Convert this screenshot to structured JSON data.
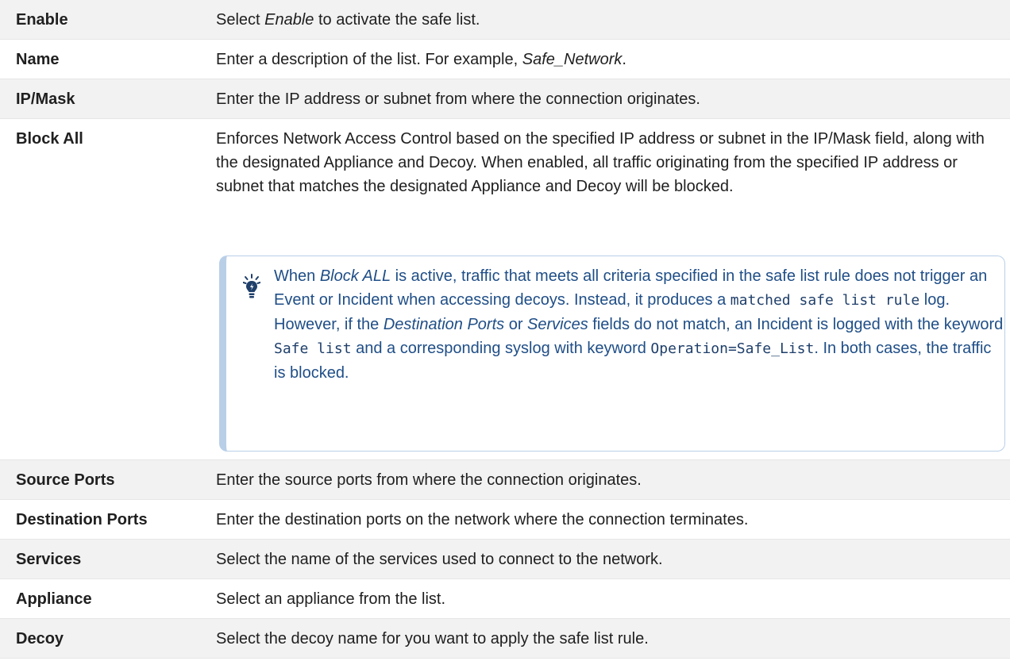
{
  "rows": [
    {
      "label": "Enable",
      "desc": [
        "Select ",
        {
          "i": "Enable"
        },
        " to activate the safe list."
      ]
    },
    {
      "label": "Name",
      "desc": [
        "Enter a description of the list. For example, ",
        {
          "i": "Safe_Network"
        },
        "."
      ]
    },
    {
      "label": "IP/Mask",
      "desc": [
        "Enter the IP address or subnet from where the connection originates."
      ]
    },
    {
      "label": "Block All",
      "desc": [
        "Enforces Network Access Control based on the specified IP address or subnet in the IP/Mask field, along with the designated Appliance and Decoy. When enabled, all traffic originating from the specified IP address or subnet that matches the designated Appliance and Decoy will be blocked."
      ]
    },
    {
      "label": "Source Ports",
      "desc": [
        "Enter the source ports from where the connection originates."
      ]
    },
    {
      "label": "Destination Ports",
      "desc": [
        "Enter the destination ports on the network where the connection terminates."
      ]
    },
    {
      "label": "Services",
      "desc": [
        "Select the name of the services used to connect to the network."
      ]
    },
    {
      "label": "Appliance",
      "desc": [
        "Select an appliance from the list."
      ]
    },
    {
      "label": "Decoy",
      "desc": [
        "Select the decoy name for you want to apply the safe list rule."
      ]
    }
  ],
  "note": {
    "icon": "lightbulb-icon",
    "parts": [
      "When ",
      {
        "i": "Block ALL"
      },
      " is active, traffic that meets all criteria specified in the safe list rule does not trigger an Event or Incident when accessing decoys. Instead, it produces a ",
      {
        "code": "matched safe list rule"
      },
      " log. However, if the ",
      {
        "i": "Destination Ports"
      },
      " or ",
      {
        "i": "Services"
      },
      " fields do not match, an Incident is logged with the keyword ",
      {
        "code": "Safe list"
      },
      " and a corresponding syslog with keyword ",
      {
        "code": "Operation=Safe_List"
      },
      ". In both cases, the traffic is blocked."
    ]
  },
  "colors": {
    "accent": "#b9cfe8",
    "note_text": "#1f4e87",
    "row_alt": "#f2f2f2"
  }
}
